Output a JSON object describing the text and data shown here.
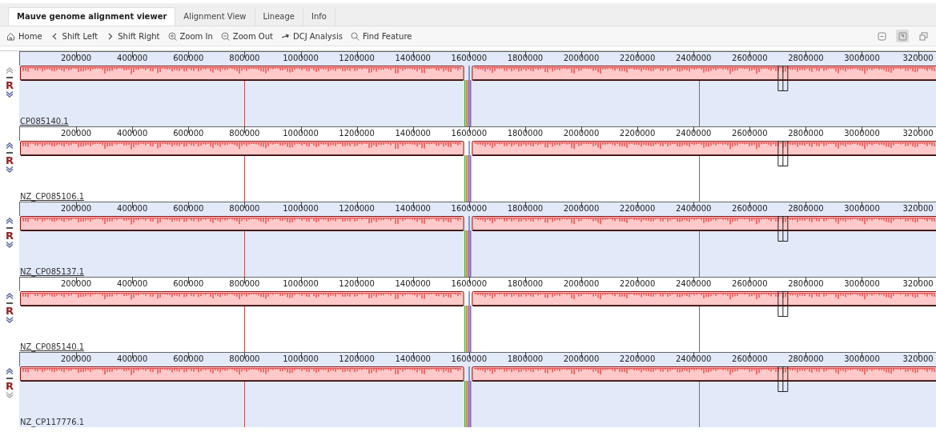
{
  "tabs": [
    {
      "label": "Mauve genome alignment viewer",
      "selected": true
    },
    {
      "label": "Alignment View",
      "selected": false
    },
    {
      "label": "Lineage",
      "selected": false
    },
    {
      "label": "Info",
      "selected": false
    }
  ],
  "toolbar": [
    {
      "kind": "home",
      "label": "Home"
    },
    {
      "kind": "left",
      "label": "Shift Left"
    },
    {
      "kind": "right",
      "label": "Shift Right"
    },
    {
      "kind": "zoom-in",
      "label": "Zoom In"
    },
    {
      "kind": "zoom-out",
      "label": "Zoom Out"
    },
    {
      "kind": "dcj",
      "label": "DCJ Analysis"
    },
    {
      "kind": "find",
      "label": "Find Feature"
    }
  ],
  "view_controls": [
    {
      "kind": "collapse",
      "selected": false
    },
    {
      "kind": "fit",
      "selected": true
    },
    {
      "kind": "popout",
      "selected": false
    }
  ],
  "genomes": [
    {
      "name": "CP085140.1",
      "link": true,
      "shaded": true,
      "move_up_enabled": false,
      "move_down_enabled": true,
      "reverse_label": "R",
      "ruler_ticks": [
        "200000",
        "400000",
        "600000",
        "800000",
        "1000000",
        "1200000",
        "1400000",
        "1600000",
        "1800000",
        "2000000",
        "2200000",
        "2400000",
        "2600000",
        "2800000",
        "3000000",
        "320000"
      ]
    },
    {
      "name": "NZ_CP085106.1",
      "link": true,
      "shaded": false,
      "move_up_enabled": true,
      "move_down_enabled": true,
      "reverse_label": "R",
      "ruler_ticks": [
        "200000",
        "400000",
        "600000",
        "800000",
        "1000000",
        "1200000",
        "1400000",
        "1600000",
        "1800000",
        "2000000",
        "2200000",
        "2400000",
        "2600000",
        "2800000",
        "3000000",
        "320000"
      ]
    },
    {
      "name": "NZ_CP085137.1",
      "link": true,
      "shaded": true,
      "move_up_enabled": true,
      "move_down_enabled": true,
      "reverse_label": "R",
      "ruler_ticks": [
        "200000",
        "400000",
        "600000",
        "800000",
        "1000000",
        "1200000",
        "1400000",
        "1600000",
        "1800000",
        "2000000",
        "2200000",
        "2400000",
        "2600000",
        "2800000",
        "3000000",
        "320000"
      ]
    },
    {
      "name": "NZ_CP085140.1",
      "link": true,
      "shaded": false,
      "move_up_enabled": true,
      "move_down_enabled": true,
      "reverse_label": "R",
      "ruler_ticks": [
        "200000",
        "400000",
        "600000",
        "800000",
        "1000000",
        "1200000",
        "1400000",
        "1600000",
        "1800000",
        "2000000",
        "2200000",
        "2400000",
        "2600000",
        "2800000",
        "3000000",
        "320000"
      ]
    },
    {
      "name": "NZ_CP117776.1",
      "link": false,
      "shaded": true,
      "move_up_enabled": true,
      "move_down_enabled": false,
      "reverse_label": "R",
      "ruler_ticks": [
        "200000",
        "400000",
        "600000",
        "800000",
        "1000000",
        "1200000",
        "1400000",
        "1600000",
        "1800000",
        "2000000",
        "2200000",
        "2400000",
        "2600000",
        "2800000",
        "3000000",
        "320000"
      ]
    }
  ]
}
